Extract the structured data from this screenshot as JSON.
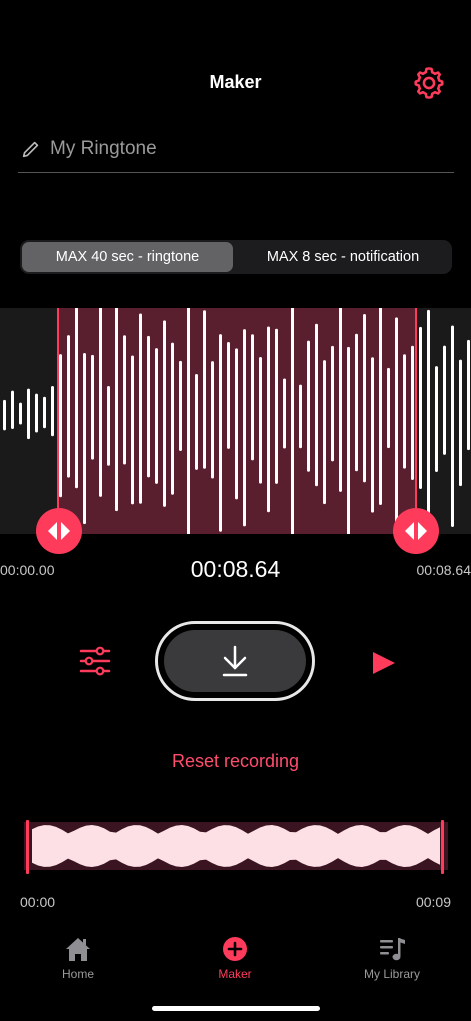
{
  "header": {
    "title": "Maker",
    "settings_icon": "gear-icon"
  },
  "name_field": {
    "placeholder": "My Ringtone",
    "value": "",
    "icon": "pencil-icon"
  },
  "segmented": {
    "options": [
      "MAX 40 sec - ringtone",
      "MAX 8 sec - notification"
    ],
    "selected": "MAX 40 sec - ringtone"
  },
  "waveform": {
    "start_label": "00:00.00",
    "current_time": "00:08.64",
    "end_label": "00:08.64",
    "selection_color": "#5a1f2e",
    "accent": "#ff3b5c"
  },
  "controls": {
    "equalizer_icon": "sliders-icon",
    "download_icon": "download-icon",
    "play_icon": "play-icon",
    "reset_label": "Reset recording"
  },
  "overview": {
    "start": "00:00",
    "end": "00:09"
  },
  "tabbar": {
    "items": [
      {
        "label": "Home",
        "icon": "home-icon"
      },
      {
        "label": "Maker",
        "icon": "plus-circle-icon"
      },
      {
        "label": "My Library",
        "icon": "music-list-icon"
      }
    ],
    "active": "Maker"
  }
}
